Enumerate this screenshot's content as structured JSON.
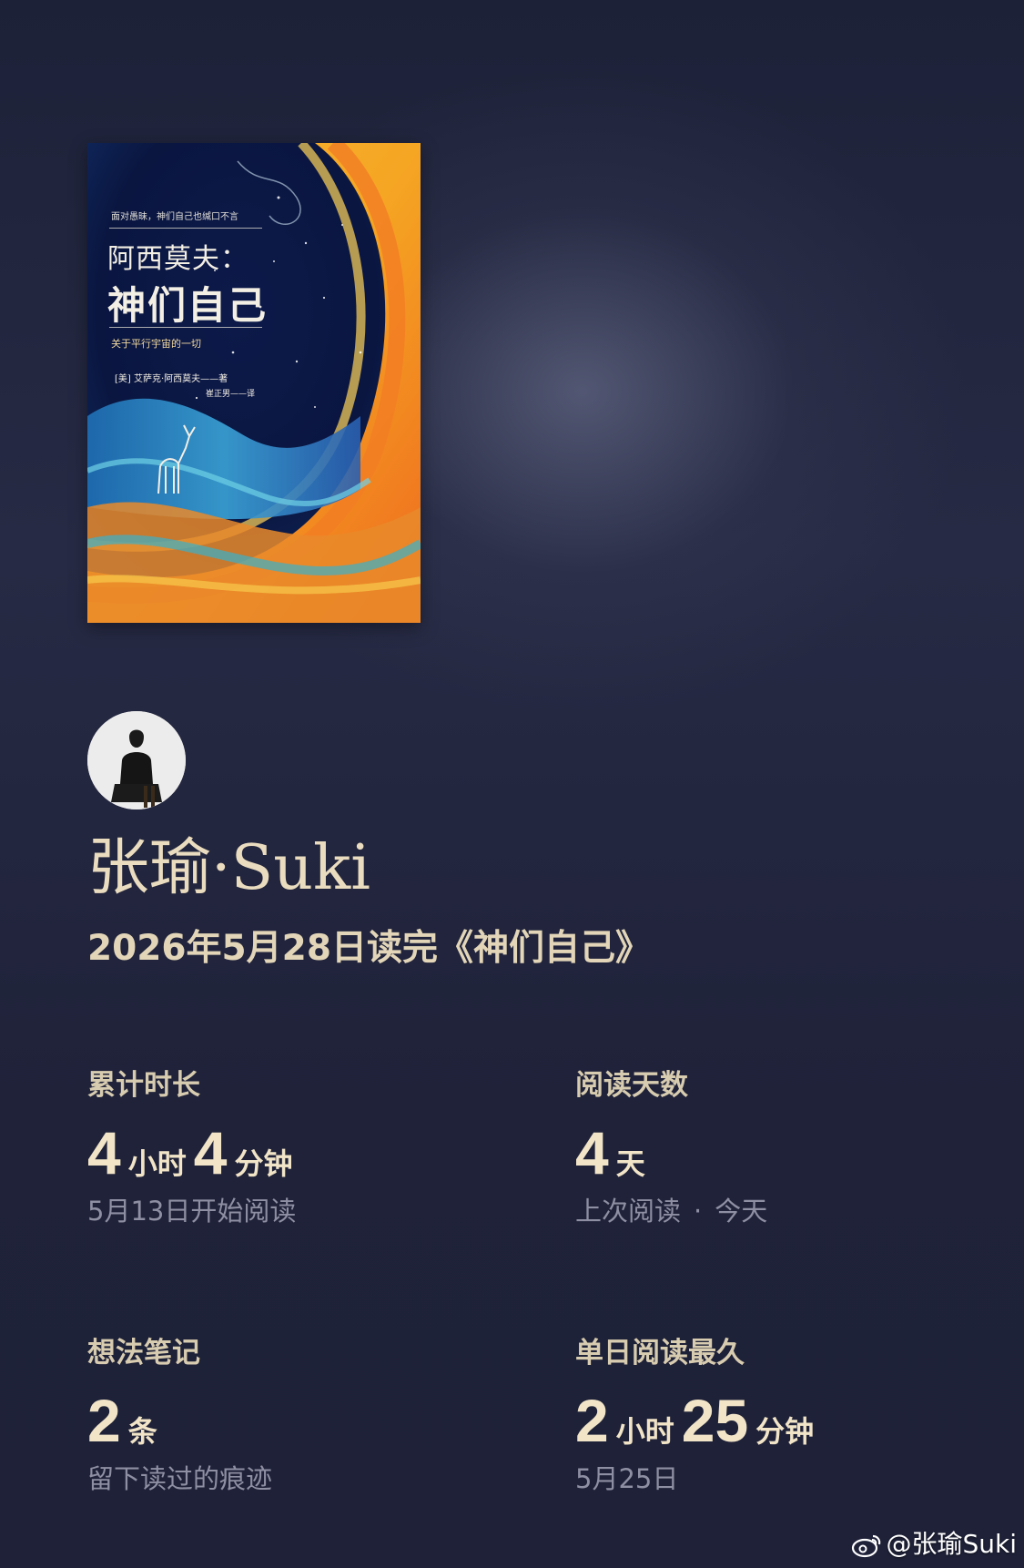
{
  "cover": {
    "tagline": "面对愚昧，神们自己也缄口不言",
    "title_line1": "阿西莫夫：",
    "title_line2": "神们自己",
    "subtitle": "关于平行宇宙的一切",
    "author": "[美] 艾萨克·阿西莫夫——著",
    "translator": "崔正男——译"
  },
  "user": {
    "name": "张瑜·Suki",
    "finished_text": "2026年5月28日读完《神们自己》"
  },
  "stats": {
    "total_time": {
      "label": "累计时长",
      "hours": "4",
      "hours_unit": "小时",
      "minutes": "4",
      "minutes_unit": "分钟",
      "sub": "5月13日开始阅读"
    },
    "reading_days": {
      "label": "阅读天数",
      "days": "4",
      "days_unit": "天",
      "sub_left": "上次阅读",
      "sub_dot": "·",
      "sub_right": "今天"
    },
    "notes": {
      "label": "想法笔记",
      "count": "2",
      "count_unit": "条",
      "sub": "留下读过的痕迹"
    },
    "longest_day": {
      "label": "单日阅读最久",
      "hours": "2",
      "hours_unit": "小时",
      "minutes": "25",
      "minutes_unit": "分钟",
      "sub": "5月25日"
    }
  },
  "watermark": {
    "text": "@张瑜Suki",
    "icon": "weibo-icon"
  },
  "colors": {
    "background": "#1f2239",
    "title": "#eadcbf",
    "value": "#f1e4c7",
    "muted": "#8f8fa3"
  }
}
